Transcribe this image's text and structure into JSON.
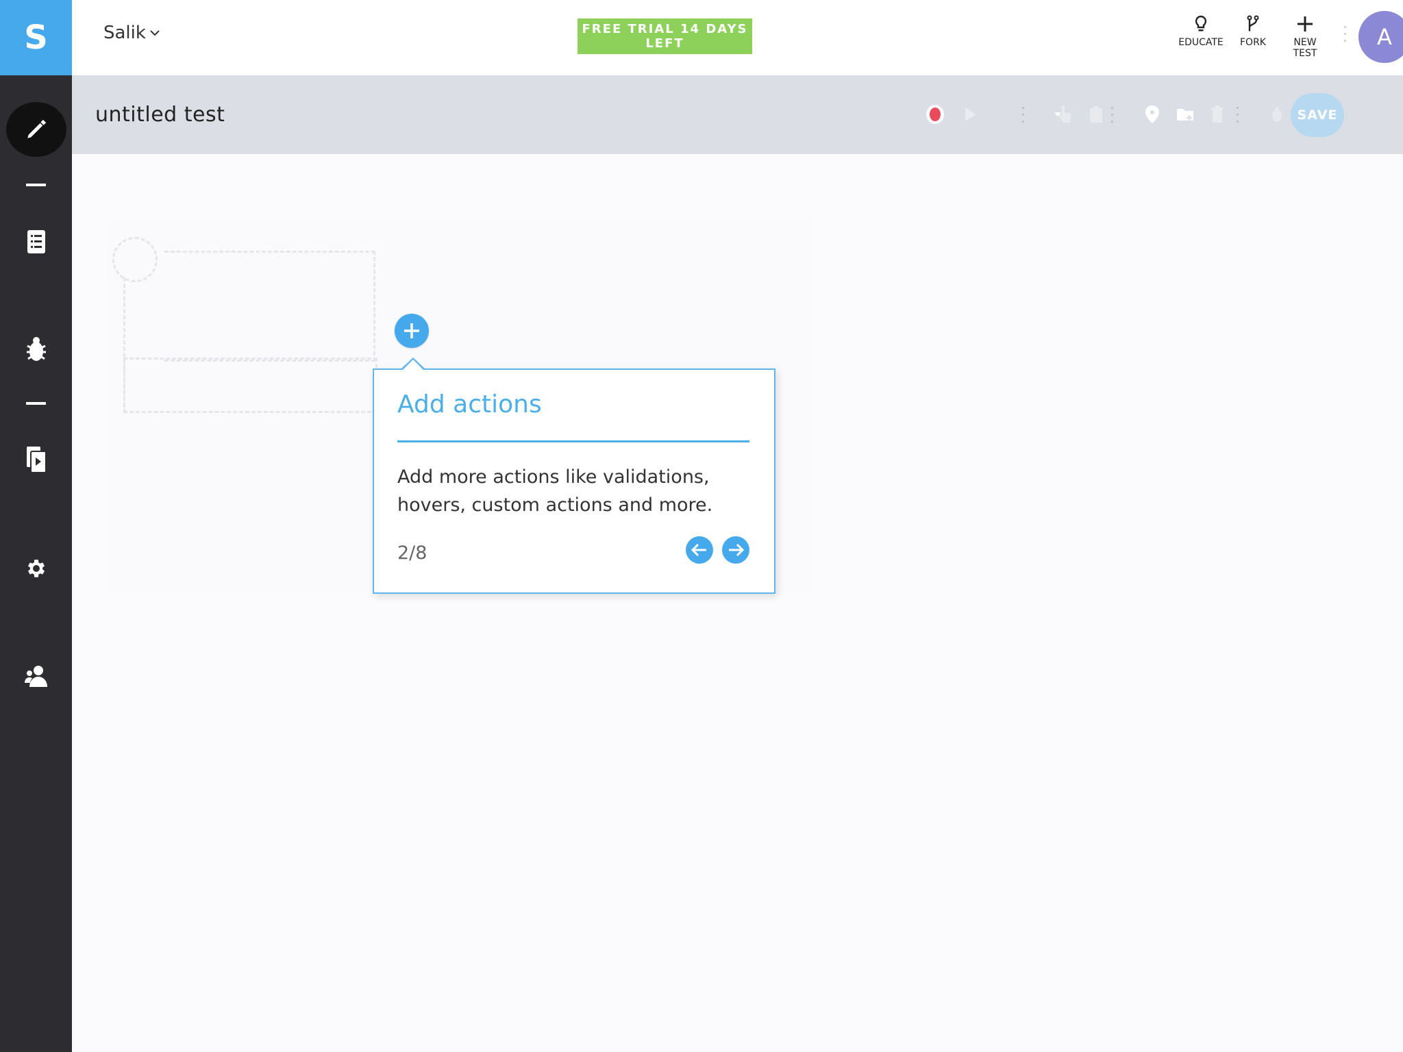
{
  "sidebar": {
    "logo_letter": "S",
    "items": [
      {
        "name": "pencil-icon",
        "active": true
      },
      {
        "name": "list-icon"
      },
      {
        "name": "bug-icon"
      },
      {
        "name": "run-icon"
      },
      {
        "name": "gear-icon"
      },
      {
        "name": "users-icon"
      }
    ]
  },
  "header": {
    "project": "Salik",
    "trial_label": "FREE TRIAL 14 DAYS LEFT",
    "actions": [
      {
        "label": "EDUCATE",
        "icon": "lightbulb-icon"
      },
      {
        "label": "FORK",
        "icon": "fork-icon"
      },
      {
        "label": "NEW TEST",
        "icon": "plus-icon"
      }
    ],
    "avatar_letter": "A"
  },
  "toolbar": {
    "title": "untitled test",
    "save_label": "SAVE",
    "colors": {
      "record": "#ea4a5a",
      "accent": "#46a9ec"
    }
  },
  "tooltip": {
    "title": "Add actions",
    "body": "Add more actions like validations, hovers, custom actions and more.",
    "step": "2/8"
  }
}
